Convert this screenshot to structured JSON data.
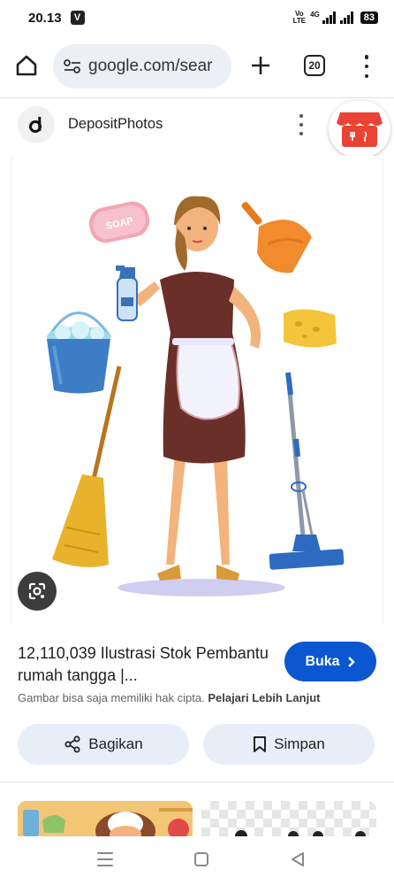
{
  "status_bar": {
    "time": "20.13",
    "notif_icon": "V",
    "volte_top": "Vo",
    "volte_bottom": "LTE",
    "net_tag": "4G",
    "battery": "83"
  },
  "toolbar": {
    "url": "google.com/sear",
    "tab_count": "20"
  },
  "source": {
    "name": "DepositPhotos"
  },
  "result": {
    "title": "12,110,039 Ilustrasi Stok Pembantu rumah tangga |...",
    "visit_label": "Buka",
    "copyright_text": "Gambar bisa saja memiliki hak cipta.",
    "learn_more": "Pelajari Lebih Lanjut",
    "share_label": "Bagikan",
    "save_label": "Simpan"
  },
  "image": {
    "soap_text": "SOAP"
  },
  "colors": {
    "accent": "#0b57d0",
    "action_bg": "#e8eef8",
    "shop_red": "#ea4335"
  }
}
